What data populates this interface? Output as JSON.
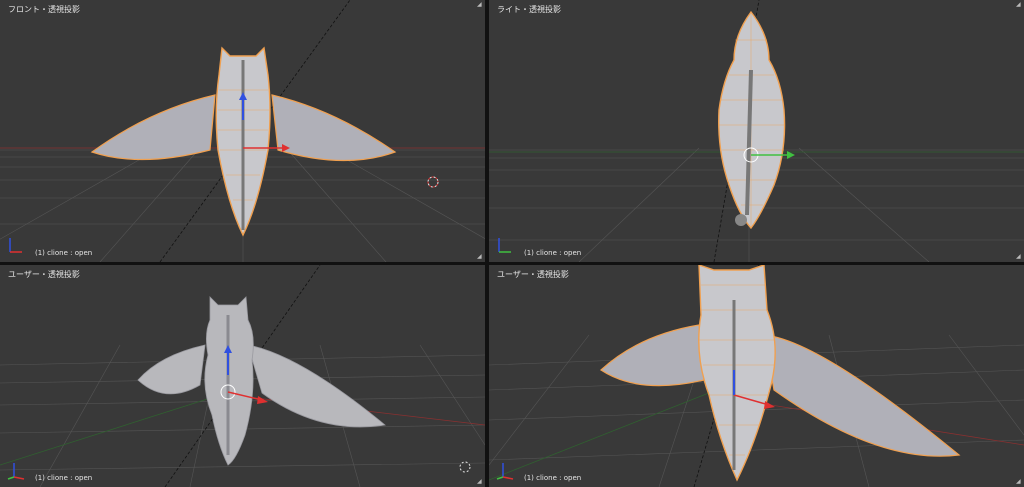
{
  "viewports": [
    {
      "title": "フロント・透視投影",
      "object_info": "(1) clione : open",
      "view": "front"
    },
    {
      "title": "ライト・透視投影",
      "object_info": "(1) clione : open",
      "view": "right"
    },
    {
      "title": "ユーザー・透視投影",
      "object_info": "(1) clione : open",
      "view": "user-solid"
    },
    {
      "title": "ユーザー・透視投影",
      "object_info": "(1) clione : open",
      "view": "user-wire"
    }
  ],
  "colors": {
    "viewport_bg": "#393939",
    "grid": "#555555",
    "wire": "#f0a050",
    "bone": "#9a9aa0",
    "solid": "#b8b8bc",
    "axis_x": "#e03030",
    "axis_y": "#40c040",
    "axis_z": "#3050e0"
  },
  "icons": [
    "axis-gizmo-icon",
    "3d-cursor-icon",
    "corner-handle-icon"
  ]
}
